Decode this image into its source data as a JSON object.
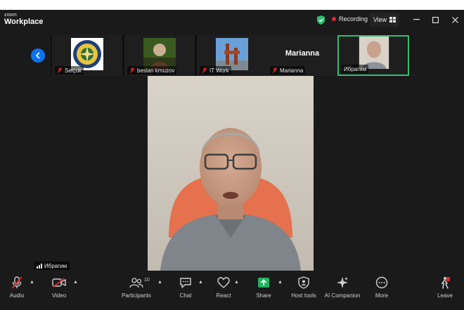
{
  "app": {
    "brand_small": "zoom",
    "brand_big": "Workplace"
  },
  "titlebar": {
    "recording_label": "Recording",
    "view_label": "View"
  },
  "gallery": {
    "tiles": [
      {
        "name": "Selçuk"
      },
      {
        "name": "beslan kmuzov"
      },
      {
        "name": "IT Work"
      },
      {
        "name": "Marianna",
        "display_name": "Marianna"
      },
      {
        "name": "Ибрагим"
      }
    ]
  },
  "speaker": {
    "name": "Ибрагим"
  },
  "toolbar": {
    "audio": "Audio",
    "video": "Video",
    "participants": "Participants",
    "participants_count": "10",
    "chat": "Chat",
    "react": "React",
    "share": "Share",
    "host_tools": "Host tools",
    "ai_companion": "AI Companion",
    "more": "More",
    "leave": "Leave"
  },
  "colors": {
    "accent": "#0e72ed",
    "share_green": "#23b35e",
    "active_border": "#2fbf71",
    "record_red": "#e02828",
    "mic_off_red": "#e02828"
  }
}
